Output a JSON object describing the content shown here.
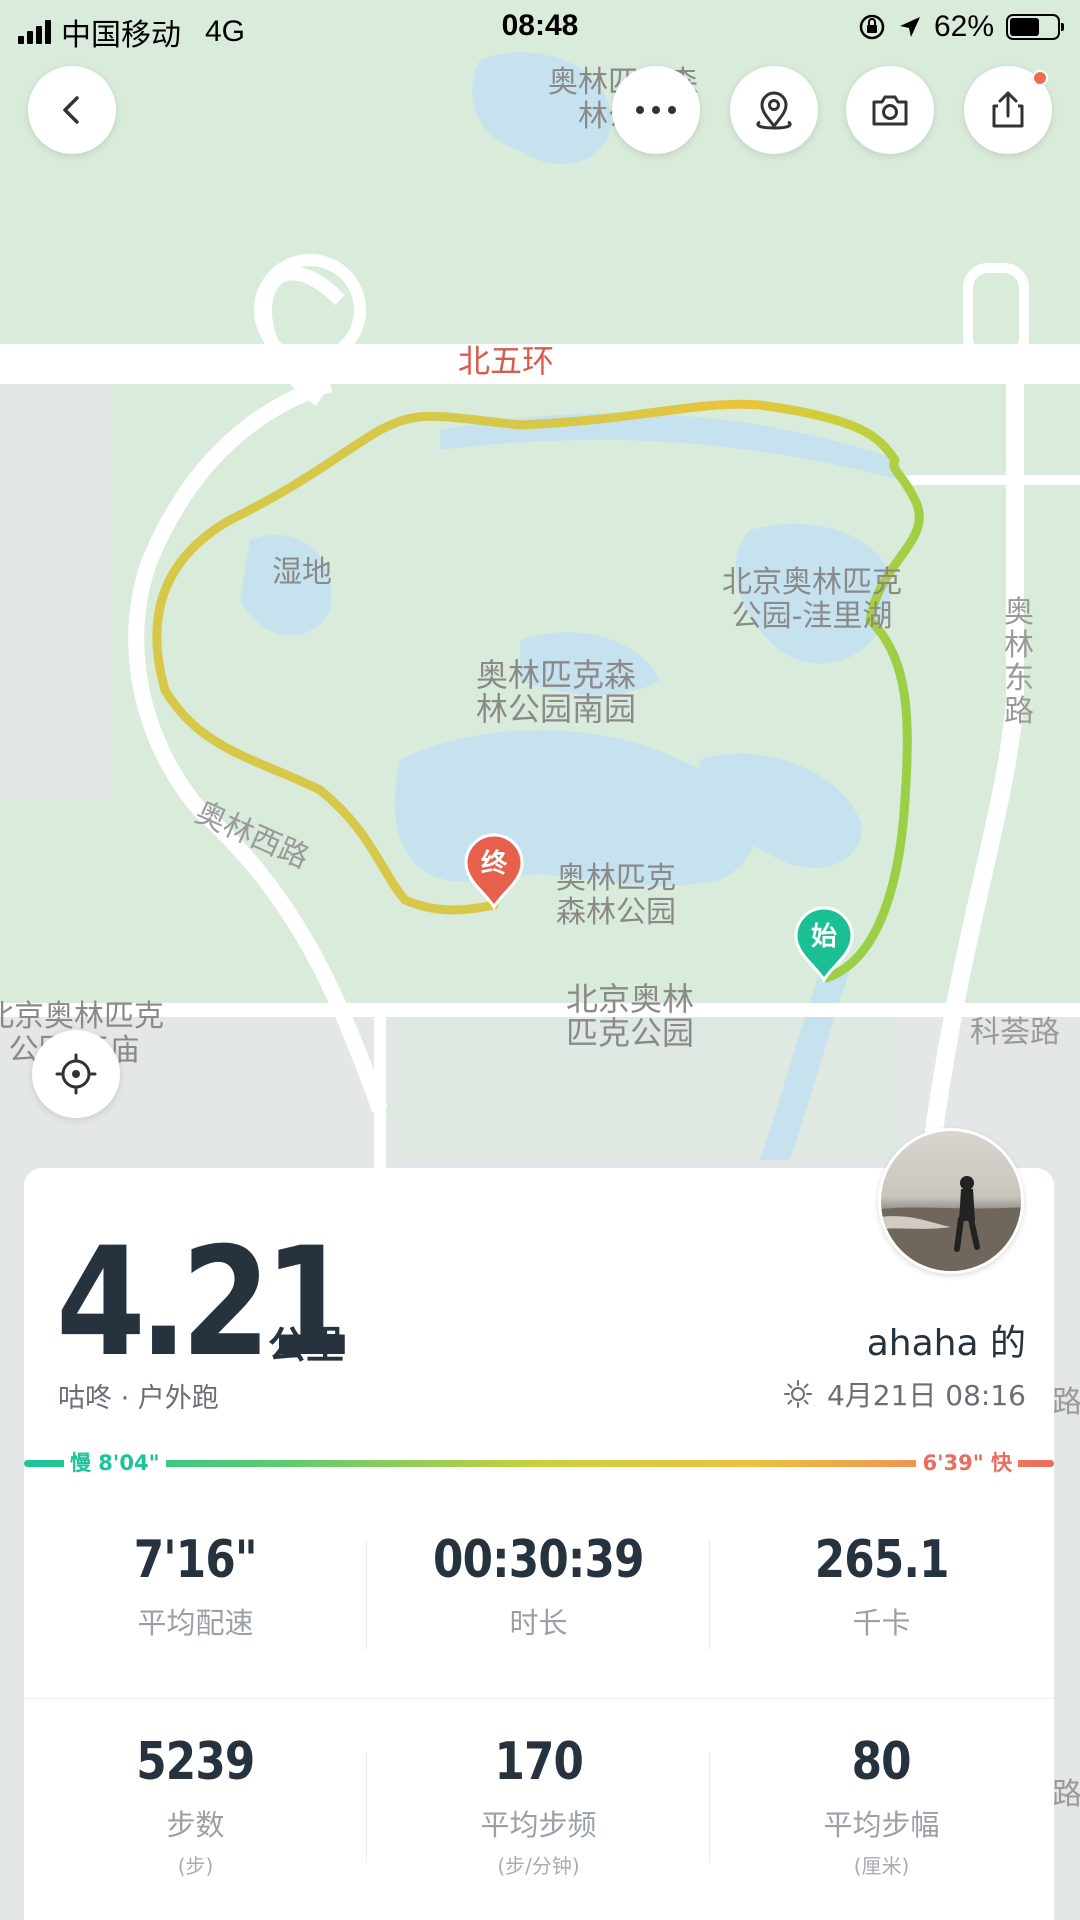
{
  "status_bar": {
    "carrier": "中国移动",
    "network": "4G",
    "time": "08:48",
    "battery": "62%"
  },
  "toolbar": {
    "back_icon": "chevron-left-icon",
    "more_icon": "more-dots-icon",
    "location_icon": "location-pin-icon",
    "camera_icon": "camera-icon",
    "share_icon": "share-icon",
    "share_has_notification": true
  },
  "map": {
    "labels": {
      "top_park": "奥林匹克森\n林公园",
      "ring_road": "北五环",
      "wetland": "湿地",
      "wali_lake": "北京奥林匹克\n公园-洼里湖",
      "south_park": "奥林匹克森\n林公园南园",
      "olin_east": "奥\n林\n东\n路",
      "olin_west": "奥林西路",
      "olympic_forest": "奥林匹克\n森林公园",
      "beijing_olympic": "北京奥林\n匹克公园",
      "kehui_road": "科荟路",
      "left_park": "北京奥林匹克\n公园-王庙",
      "right_edge_1": "路",
      "right_edge_2": "路"
    },
    "markers": {
      "end": "终",
      "start": "始"
    },
    "route_colors": [
      "#e6b83a",
      "#e9c43a",
      "#c8d03e",
      "#9ccf45"
    ]
  },
  "summary": {
    "distance": "4.21",
    "distance_unit": "公里",
    "activity": "咕咚 · 户外跑",
    "username": "ahaha 的",
    "date": "4月21日 08:16",
    "weather_icon": "sun-icon"
  },
  "pace": {
    "slow_label": "慢 8'04\"",
    "fast_label": "6'39\" 快",
    "slow_color": "#1cc49a",
    "fast_color": "#ea6c5c"
  },
  "stats": [
    {
      "value": "7'16\"",
      "label": "平均配速",
      "sub": ""
    },
    {
      "value": "00:30:39",
      "label": "时长",
      "sub": ""
    },
    {
      "value": "265.1",
      "label": "千卡",
      "sub": ""
    },
    {
      "value": "5239",
      "label": "步数",
      "sub": "(步)"
    },
    {
      "value": "170",
      "label": "平均步频",
      "sub": "(步/分钟)"
    },
    {
      "value": "80",
      "label": "平均步幅",
      "sub": "(厘米)"
    }
  ]
}
